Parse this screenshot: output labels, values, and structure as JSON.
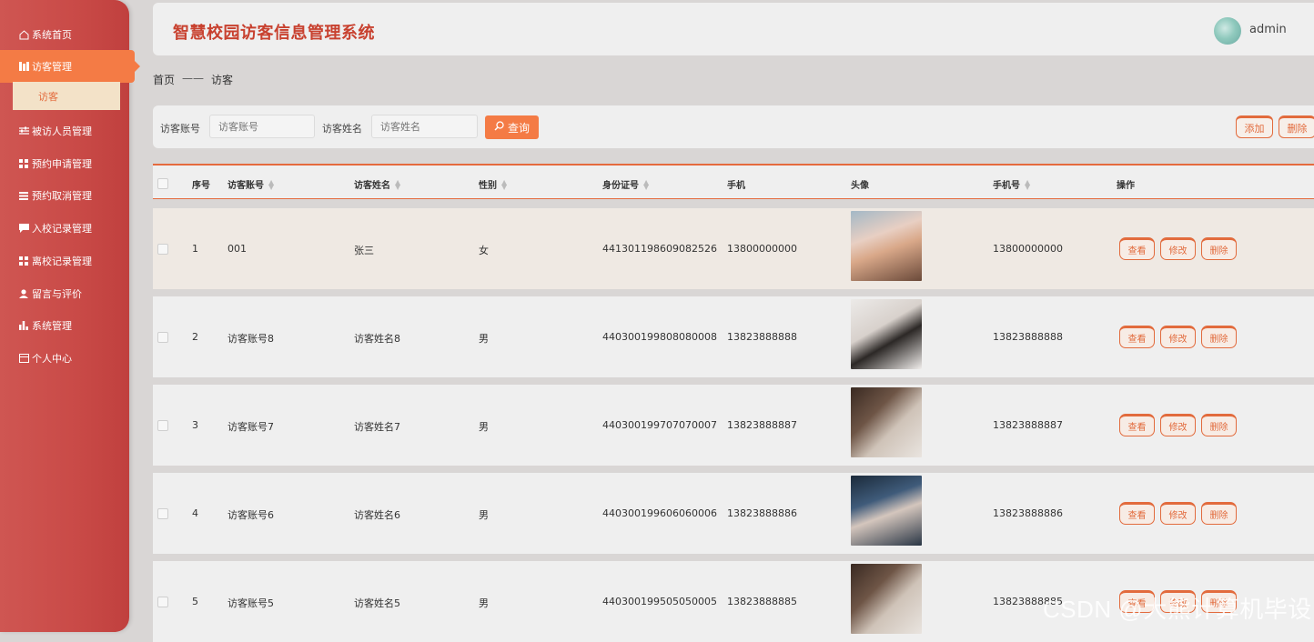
{
  "header": {
    "title": "智慧校园访客信息管理系统",
    "username": "admin"
  },
  "sidebar": {
    "items": [
      {
        "label": "系统首页",
        "icon": "home-icon"
      },
      {
        "label": "访客管理",
        "icon": "grid-icon"
      },
      {
        "label": "被访人员管理",
        "icon": "sliders-icon"
      },
      {
        "label": "预约申请管理",
        "icon": "grid-icon"
      },
      {
        "label": "预约取消管理",
        "icon": "list-icon"
      },
      {
        "label": "入校记录管理",
        "icon": "chat-icon"
      },
      {
        "label": "离校记录管理",
        "icon": "grid-icon"
      },
      {
        "label": "留言与评价",
        "icon": "user-icon"
      },
      {
        "label": "系统管理",
        "icon": "chart-icon"
      },
      {
        "label": "个人中心",
        "icon": "card-icon"
      }
    ],
    "submenu": "访客"
  },
  "breadcrumb": {
    "home": "首页",
    "sep": "——",
    "current": "访客"
  },
  "search": {
    "account_label": "访客账号",
    "account_placeholder": "访客账号",
    "name_label": "访客姓名",
    "name_placeholder": "访客姓名",
    "query_button": "查询",
    "add_button": "添加",
    "delete_button": "删除"
  },
  "table": {
    "headers": [
      "序号",
      "访客账号",
      "访客姓名",
      "性别",
      "身份证号",
      "手机",
      "头像",
      "手机号",
      "操作"
    ],
    "rows": [
      {
        "index": "1",
        "account": "001",
        "name": "张三",
        "gender": "女",
        "id_card": "441301198609082526",
        "phone": "13800000000",
        "mobile": "13800000000"
      },
      {
        "index": "2",
        "account": "访客账号8",
        "name": "访客姓名8",
        "gender": "男",
        "id_card": "440300199808080008",
        "phone": "13823888888",
        "mobile": "13823888888"
      },
      {
        "index": "3",
        "account": "访客账号7",
        "name": "访客姓名7",
        "gender": "男",
        "id_card": "440300199707070007",
        "phone": "13823888887",
        "mobile": "13823888887"
      },
      {
        "index": "4",
        "account": "访客账号6",
        "name": "访客姓名6",
        "gender": "男",
        "id_card": "440300199606060006",
        "phone": "13823888886",
        "mobile": "13823888886"
      },
      {
        "index": "5",
        "account": "访客账号5",
        "name": "访客姓名5",
        "gender": "男",
        "id_card": "440300199505050005",
        "phone": "13823888885",
        "mobile": "13823888885"
      }
    ],
    "actions": {
      "view": "查看",
      "edit": "修改",
      "delete": "删除"
    }
  },
  "watermark": "CSDN @大熊计算机毕设",
  "colors": {
    "sidebar": "#c94a47",
    "accent": "#f47b45",
    "title": "#c8412f"
  }
}
